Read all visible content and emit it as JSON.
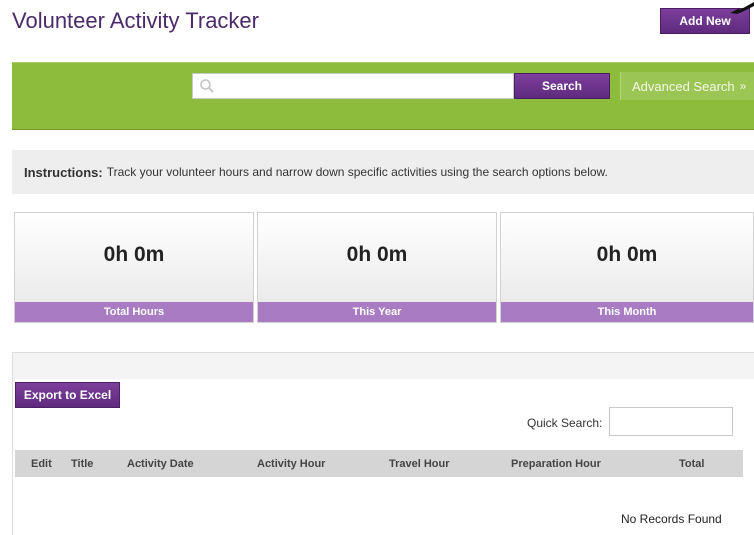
{
  "header": {
    "title": "Volunteer Activity Tracker",
    "add_new_label": "Add New"
  },
  "search": {
    "query": "",
    "button_label": "Search",
    "advanced_label": "Advanced Search"
  },
  "instructions": {
    "label": "Instructions:",
    "text": "Track your volunteer hours and narrow down specific activities using the search options below."
  },
  "stats": [
    {
      "value": "0h 0m",
      "label": "Total Hours"
    },
    {
      "value": "0h 0m",
      "label": "This Year"
    },
    {
      "value": "0h 0m",
      "label": "This Month"
    }
  ],
  "grid": {
    "export_label": "Export to Excel",
    "quick_search_label": "Quick Search:",
    "quick_search_value": "",
    "columns": [
      "Edit",
      "Title",
      "Activity Date",
      "Activity Hour",
      "Travel Hour",
      "Preparation Hour",
      "Total"
    ],
    "empty_message": "No Records Found"
  },
  "colors": {
    "accent_purple": "#5e2a7e",
    "band_green": "#8dbb3c",
    "label_lavender": "#a87bc2"
  },
  "icons": [
    "search-icon",
    "chevron-double-down-icon",
    "arrow-icon"
  ]
}
